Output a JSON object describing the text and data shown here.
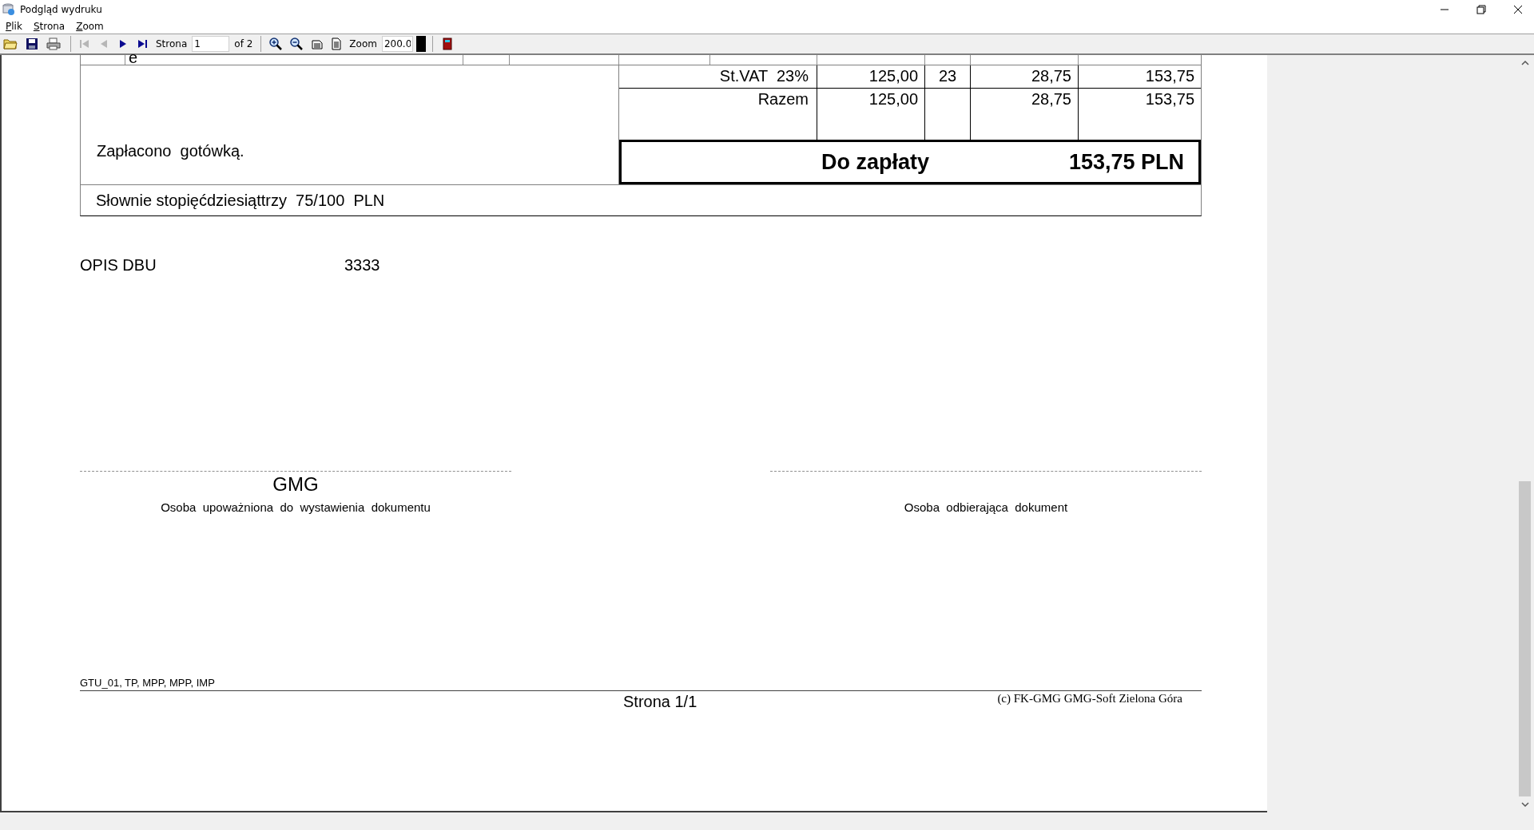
{
  "window": {
    "title": "Podgląd wydruku"
  },
  "menu": [
    {
      "label": "Plik"
    },
    {
      "label": "Strona"
    },
    {
      "label": "Zoom"
    }
  ],
  "toolbar": {
    "file_buttons": [
      {
        "kind": "open",
        "disabled": false
      },
      {
        "kind": "save",
        "disabled": false
      },
      {
        "kind": "print",
        "disabled": false
      }
    ],
    "nav_buttons": [
      {
        "kind": "first",
        "disabled": true
      },
      {
        "kind": "prev",
        "disabled": true
      },
      {
        "kind": "next",
        "disabled": false
      },
      {
        "kind": "last",
        "disabled": false
      }
    ],
    "page_label": "Strona",
    "page_value": "1",
    "page_count": "of 2",
    "view_buttons": [
      {
        "kind": "zoom-in"
      },
      {
        "kind": "zoom-out"
      },
      {
        "kind": "page-width"
      },
      {
        "kind": "whole-page"
      }
    ],
    "zoom_label": "Zoom",
    "zoom_value": "200.0"
  },
  "document": {
    "cut_row_text": "e",
    "summary_rows": [
      {
        "label": "St.VAT  23%",
        "net": "125,00",
        "rate": "23",
        "vat": "28,75",
        "gross": "153,75"
      },
      {
        "label": "Razem",
        "net": "125,00",
        "rate": "",
        "vat": "28,75",
        "gross": "153,75"
      }
    ],
    "payment_note": "Zapłacono  gotówką.",
    "to_pay": {
      "label": "Do zapłaty",
      "value": "153,75 PLN"
    },
    "in_words": "Słownie stopięćdziesiąttrzy  75/100  PLN",
    "description": {
      "label": "OPIS DBU",
      "value": "3333"
    },
    "signatures": [
      {
        "name": "GMG",
        "caption": "Osoba  upoważniona  do  wystawienia  dokumentu"
      },
      {
        "caption": "Osoba  odbierająca  dokument"
      }
    ],
    "footer": {
      "codes": "GTU_01, TP, MPP, MPP, IMP",
      "page": "Strona 1/1",
      "copyright": "(c) FK-GMG GMG-Soft Zielona Góra"
    }
  }
}
